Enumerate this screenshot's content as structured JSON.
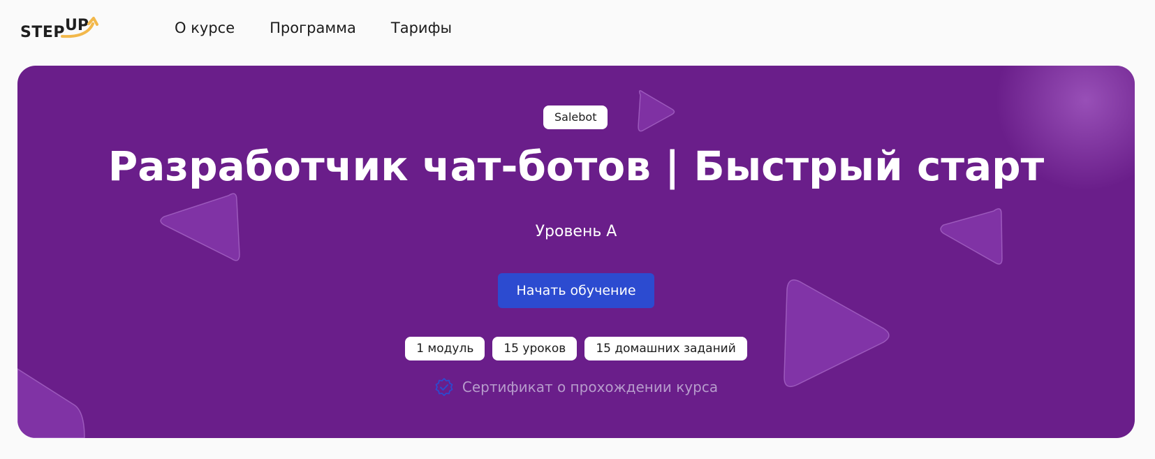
{
  "header": {
    "logo": {
      "step": "STEP",
      "up": "UP",
      "accent": "#f2b84b"
    },
    "nav": [
      {
        "label": "О курсе"
      },
      {
        "label": "Программа"
      },
      {
        "label": "Тарифы"
      }
    ]
  },
  "hero": {
    "badge": "Salebot",
    "title": "Разработчик чат-ботов | Быстрый старт",
    "level": "Уровень А",
    "cta_label": "Начать обучение",
    "chips": [
      "1 модуль",
      "15 уроков",
      "15 домашних заданий"
    ],
    "certificate": {
      "text": "Сертификат о прохождении курса",
      "icon": "verified-badge-icon"
    },
    "colors": {
      "background": "#6a1e8a",
      "button": "#2c4bd0",
      "certificate_text": "#b79ccc"
    },
    "decoration": "play-triangle-icon"
  }
}
